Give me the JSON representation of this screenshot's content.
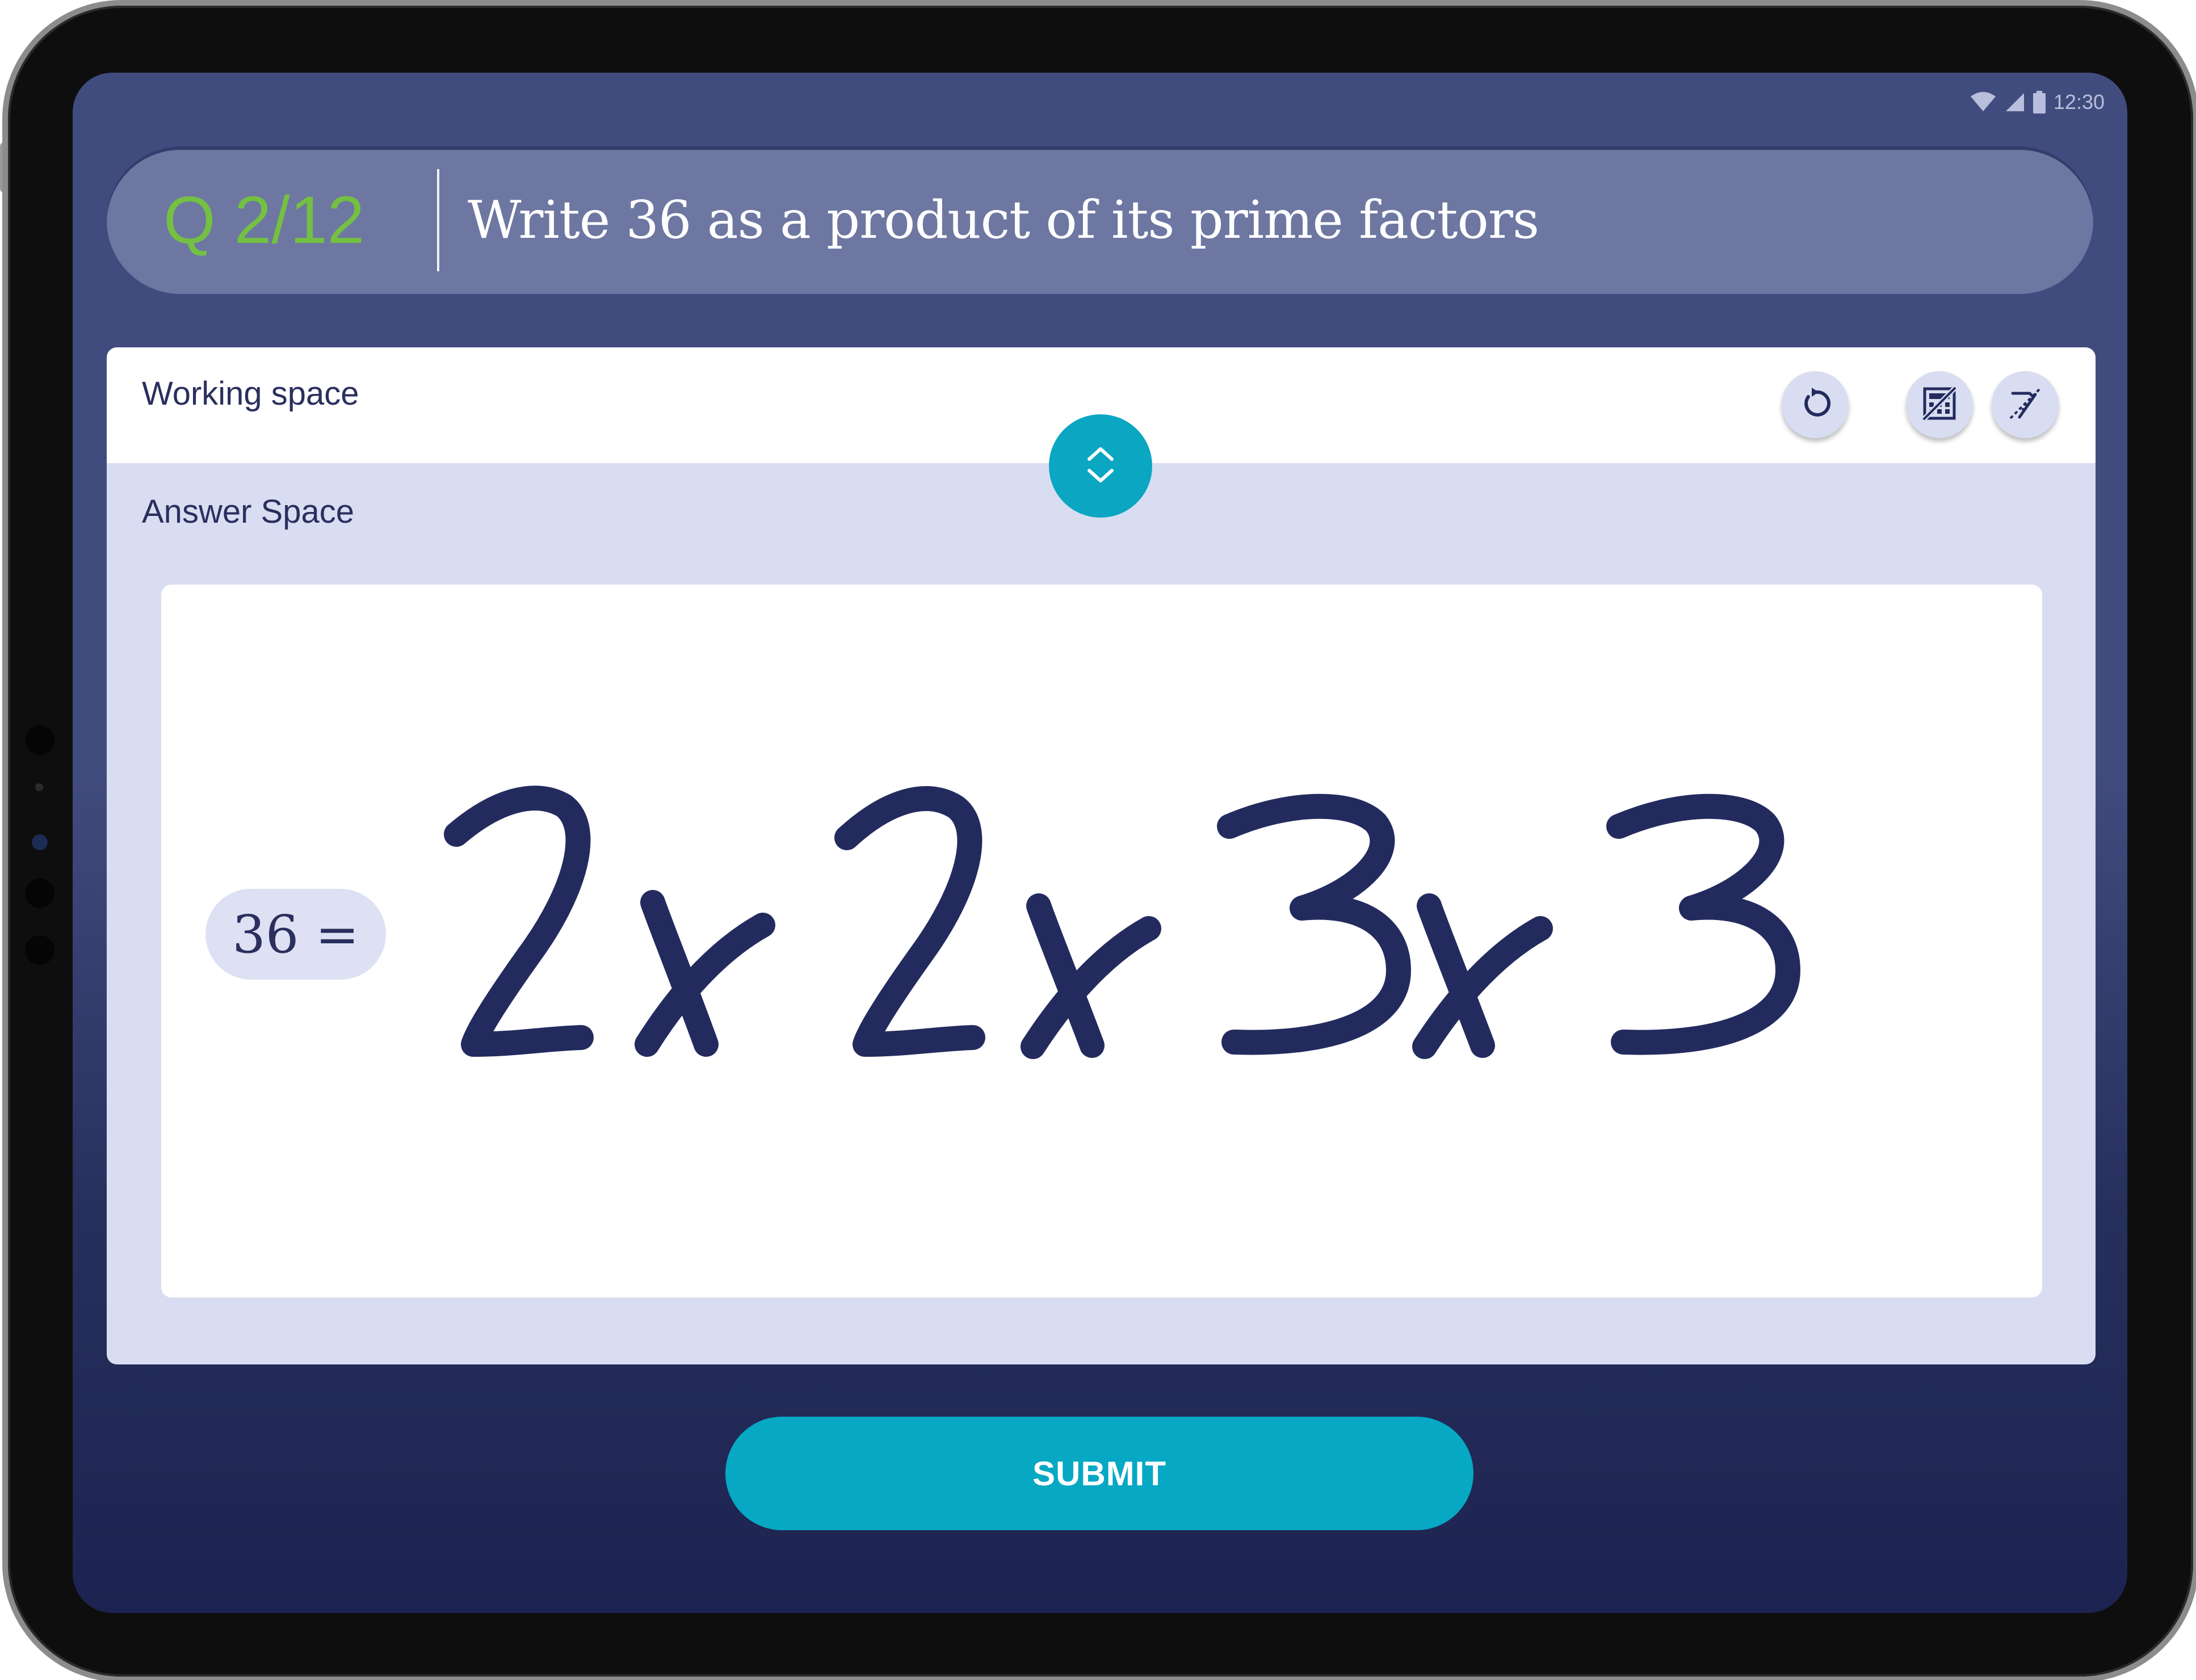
{
  "status_bar": {
    "time": "12:30",
    "icons": [
      "wifi-icon",
      "cell-signal-icon",
      "battery-icon"
    ]
  },
  "question": {
    "counter": "Q 2/12",
    "text": "Write 36 as a product of its prime factors"
  },
  "workspace": {
    "working_label": "Working space",
    "answer_label": "Answer Space",
    "tools": [
      "undo-icon",
      "calculator-disabled-icon",
      "ruler-disabled-icon"
    ],
    "toggle_icon": "expand-collapse-icon"
  },
  "answer": {
    "prefix": "36 =",
    "handwritten": "2x2x3x3"
  },
  "submit_label": "SUBMIT",
  "colors": {
    "background": "#414c7e",
    "question_bar": "#6d77a1",
    "counter_green": "#74c043",
    "accent_teal": "#06a8c3",
    "ink": "#232b5e",
    "panel_lavender": "#d8ddf1"
  }
}
